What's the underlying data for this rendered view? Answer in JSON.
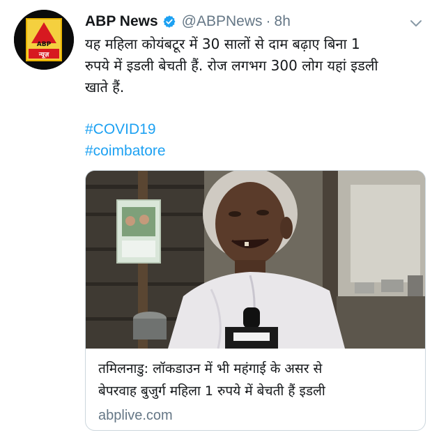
{
  "tweet": {
    "display_name": "ABP News",
    "handle": "@ABPNews",
    "separator": "·",
    "time": "8h",
    "text_lines": [
      "यह महिला कोयंबटूर में 30 सालों से दाम बढ़ाए बिना 1",
      "रुपये में इडली बेचती हैं. रोज लगभग 300 लोग यहां इडली",
      "खाते हैं."
    ],
    "hashtags": [
      "#COVID19",
      "#coimbatore"
    ],
    "avatar_logo": {
      "top": "ABP",
      "bottom": "न्यूज़"
    }
  },
  "card": {
    "title_lines": [
      "तमिलनाडु: लॉकडाउन में भी महंगाई के असर से",
      "बेपरवाह बुजुर्ग महिला 1 रुपये में बेचती हैं इडली"
    ],
    "domain": "abplive.com"
  },
  "colors": {
    "link": "#1da1f2",
    "secondary_text": "#657786",
    "verified": "#1da1f2",
    "logo_red": "#d71920"
  },
  "icons": {
    "verified": "verified-badge-icon",
    "more": "chevron-down-icon"
  }
}
